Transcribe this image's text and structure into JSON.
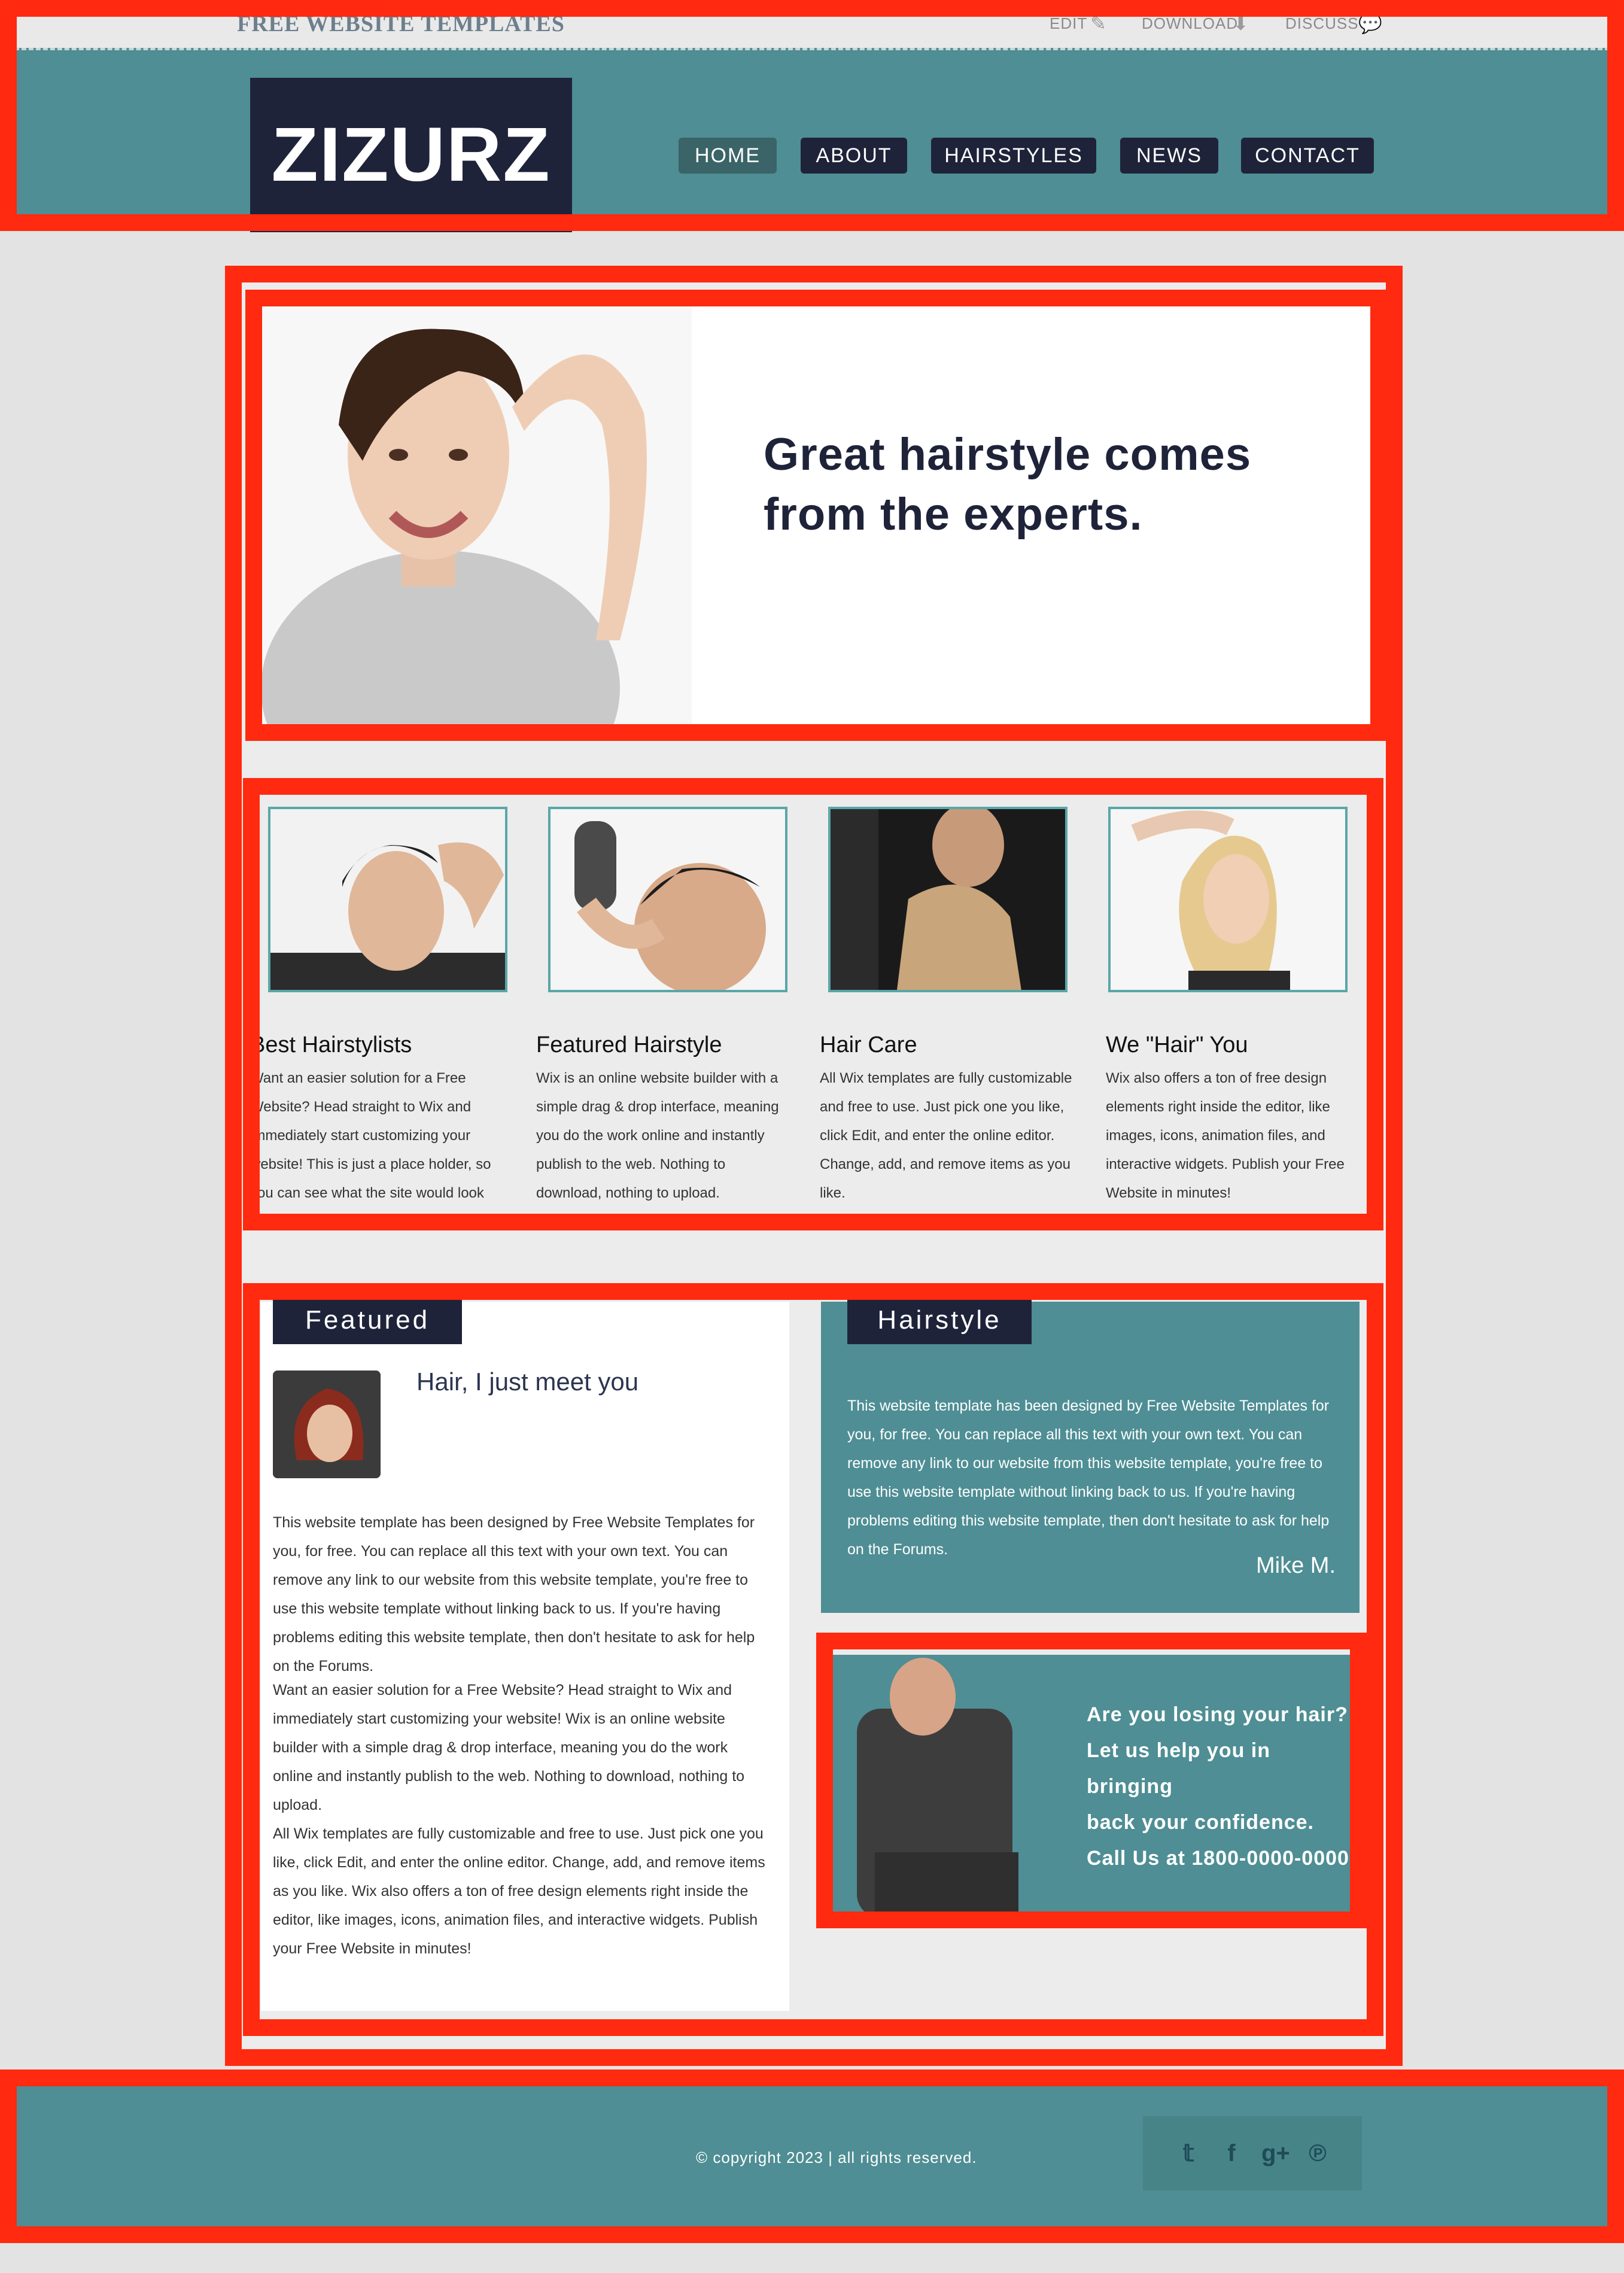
{
  "topbar": {
    "brand": "FREE WEBSITE TEMPLATES",
    "edit": "EDIT",
    "download": "DOWNLOAD",
    "discuss": "DISCUSS"
  },
  "logo": "ZIZURZ",
  "nav": [
    "HOME",
    "ABOUT",
    "HAIRSTYLES",
    "NEWS",
    "CONTACT"
  ],
  "banner": {
    "line1": "Great hairstyle comes",
    "line2": "from the experts."
  },
  "columns": [
    {
      "title": "Best Hairstylists",
      "text": "Want an easier solution for a Free Website? Head straight to Wix and immediately start customizing your website! This is just a place holder, so you can see what the site would look"
    },
    {
      "title": "Featured Hairstyle",
      "text": "Wix is an online website builder with a simple drag & drop interface, meaning you do the work online and instantly publish to the web. Nothing to download, nothing to upload."
    },
    {
      "title": "Hair Care",
      "text": "All Wix templates are fully customizable and free to use. Just pick one you like, click Edit, and enter the online editor. Change, add, and remove items as you like."
    },
    {
      "title": "We \"Hair\" You",
      "text": "Wix also offers a ton of free design elements right inside the editor, like images, icons, animation files, and interactive widgets. Publish your Free Website in minutes!"
    }
  ],
  "featured": {
    "tab": "Featured",
    "heading": "Hair, I just meet you",
    "p1": "This website template has been designed by Free Website Templates for you, for free. You can replace all this text with your own text. You can remove any link to our website from this website template, you're free to use this website template without linking back to us. If you're having problems editing this website template, then don't hesitate to ask for help on the Forums.",
    "p2": "Want an easier solution for a Free Website? Head straight to Wix and immediately start customizing your website! Wix is an online website builder with a simple drag & drop interface, meaning you do the work online and instantly publish to the web. Nothing to download, nothing to upload.",
    "p3": "All Wix templates are fully customizable and free to use. Just pick one you like, click Edit, and enter the online editor. Change, add, and remove items as you like. Wix also offers a ton of free design elements right inside the editor, like images, icons, animation files, and interactive widgets. Publish your Free Website in minutes!"
  },
  "hairstyle": {
    "tab": "Hairstyle",
    "text": "This website template has been designed by Free Website Templates for you, for free. You can replace all this text with your own text. You can remove any link to our website from this website template, you're free to use this website template without linking back to us. If you're having problems editing this website template, then don't hesitate to ask for help on the Forums.",
    "signature": "Mike M."
  },
  "promo": {
    "l1": "Are you losing your hair?",
    "l2": "Let us help you in bringing",
    "l3": "back your confidence.",
    "l4": "Call Us at 1800-0000-0000"
  },
  "footer": {
    "copyright": "© copyright 2023 | all rights reserved.",
    "social": [
      "twitter-icon",
      "facebook-icon",
      "googleplus-icon",
      "pinterest-icon"
    ]
  },
  "colors": {
    "teal": "#4e8e94",
    "navy": "#1f2339",
    "highlight": "#ff2a0f"
  }
}
